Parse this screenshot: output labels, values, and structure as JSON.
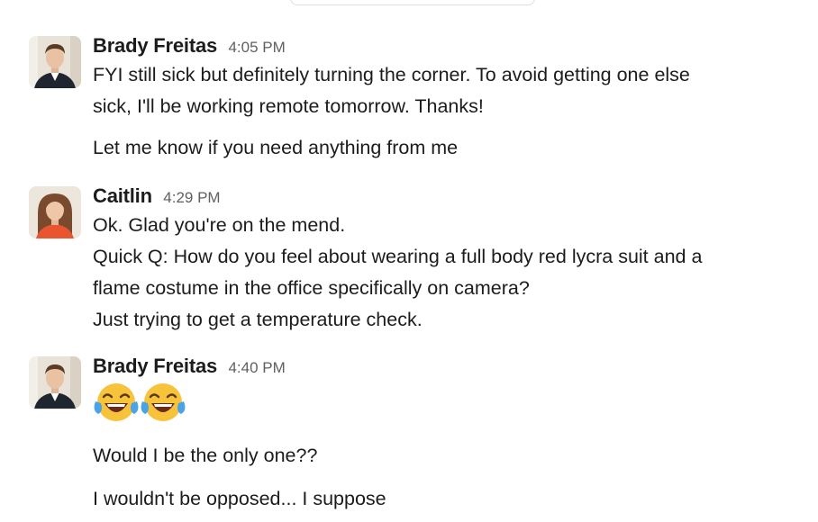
{
  "messages": [
    {
      "sender": "Brady Freitas",
      "time": "4:05 PM",
      "lines": [
        "FYI still sick but definitely turning the corner. To avoid getting one else",
        "sick, I'll be working remote tomorrow. Thanks!",
        "Let me know if you need anything from me"
      ]
    },
    {
      "sender": "Caitlin",
      "time": "4:29 PM",
      "lines": [
        "Ok. Glad you're on the mend.",
        "Quick Q: How do you feel about wearing a full body red lycra suit and a",
        "flame costume in the office specifically on camera?",
        "Just trying to get a temperature check."
      ]
    },
    {
      "sender": "Brady Freitas",
      "time": "4:40 PM",
      "emojis": [
        "face-with-tears-of-joy-emoji",
        "face-with-tears-of-joy-emoji"
      ],
      "lines": [
        "Would I be the only one??",
        "I wouldn't be opposed... I suppose"
      ]
    }
  ]
}
